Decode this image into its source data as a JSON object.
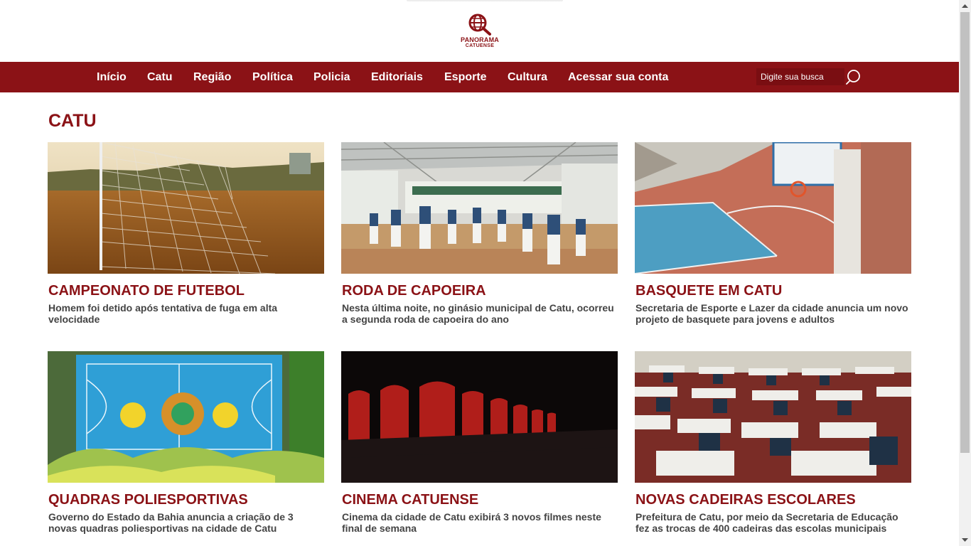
{
  "brand": {
    "name_line1": "PANORAMA",
    "name_line2": "CATUENSE",
    "color": "#8b1216"
  },
  "nav": {
    "items": [
      {
        "label": "Início"
      },
      {
        "label": "Catu"
      },
      {
        "label": "Região"
      },
      {
        "label": "Política"
      },
      {
        "label": "Policia"
      },
      {
        "label": "Editoriais"
      },
      {
        "label": "Esporte"
      },
      {
        "label": "Cultura"
      },
      {
        "label": "Acessar sua conta"
      }
    ]
  },
  "search": {
    "placeholder": "Digite sua busca",
    "icon": "search-icon"
  },
  "section": {
    "title": "CATU"
  },
  "cards": [
    {
      "title": "CAMPEONATO DE FUTEBOL",
      "description": "Homem foi detido após tentativa de fuga em alta velocidade",
      "image": "soccer-goal-photo"
    },
    {
      "title": "RODA DE CAPOEIRA",
      "description": "Nesta última noite, no ginásio municipal de Catu, ocorreu a segunda roda de capoeira do ano",
      "image": "capoeira-gym-photo"
    },
    {
      "title": "BASQUETE EM CATU",
      "description": "Secretaria de Esporte e Lazer da cidade anuncia um novo projeto de basquete para jovens e adultos",
      "image": "basketball-court-photo"
    },
    {
      "title": "QUADRAS POLIESPORTIVAS",
      "description": "Governo do Estado da Bahia anuncia a criação de 3 novas quadras poliesportivas na cidade de Catu",
      "image": "sports-court-aerial-photo"
    },
    {
      "title": "CINEMA CATUENSE",
      "description": "Cinema da cidade de Catu exibirá 3 novos filmes neste final de semana",
      "image": "cinema-seats-photo"
    },
    {
      "title": "NOVAS CADEIRAS ESCOLARES",
      "description": "Prefeitura de Catu, por meio da Secretaria de Educação fez as trocas de 400 cadeiras das escolas municipais",
      "image": "classroom-desks-photo"
    }
  ]
}
